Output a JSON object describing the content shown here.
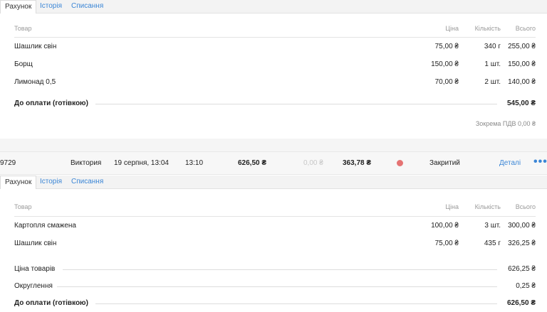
{
  "tabs1": [
    "Рахунок",
    "Історія",
    "Списання"
  ],
  "tabs2": [
    "Рахунок",
    "Історія",
    "Списання"
  ],
  "headers": {
    "item": "Товар",
    "price": "Ціна",
    "qty": "Кількість",
    "total": "Всього"
  },
  "receipt1": {
    "items": [
      {
        "name": "Шашлик свін",
        "price": "75,00 ₴",
        "qty": "340 г",
        "total": "255,00 ₴"
      },
      {
        "name": "Борщ",
        "price": "150,00 ₴",
        "qty": "1 шт.",
        "total": "150,00 ₴"
      },
      {
        "name": "Лимонад 0,5",
        "price": "70,00 ₴",
        "qty": "2 шт.",
        "total": "140,00 ₴"
      }
    ],
    "pay_label": "До оплати (готівкою)",
    "pay_value": "545,00 ₴",
    "vat_note": "Зокрема ПДВ 0,00 ₴"
  },
  "order": {
    "id": "9729",
    "waiter": "Виктория",
    "opened": "19 серпня, 13:04",
    "closed": "13:10",
    "sum": "626,50 ₴",
    "discount": "0,00 ₴",
    "profit": "363,78 ₴",
    "status_color": "#e57373",
    "status": "Закритий",
    "details": "Деталі",
    "more": "•••"
  },
  "receipt2": {
    "items": [
      {
        "name": "Картопля смажена",
        "price": "100,00 ₴",
        "qty": "3 шт.",
        "total": "300,00 ₴"
      },
      {
        "name": "Шашлик свін",
        "price": "75,00 ₴",
        "qty": "435 г",
        "total": "326,25 ₴"
      }
    ],
    "goods_label": "Ціна товарів",
    "goods_value": "626,25 ₴",
    "round_label": "Округлення",
    "round_value": "0,25 ₴",
    "pay_label": "До оплати (готівкою)",
    "pay_value": "626,50 ₴"
  }
}
